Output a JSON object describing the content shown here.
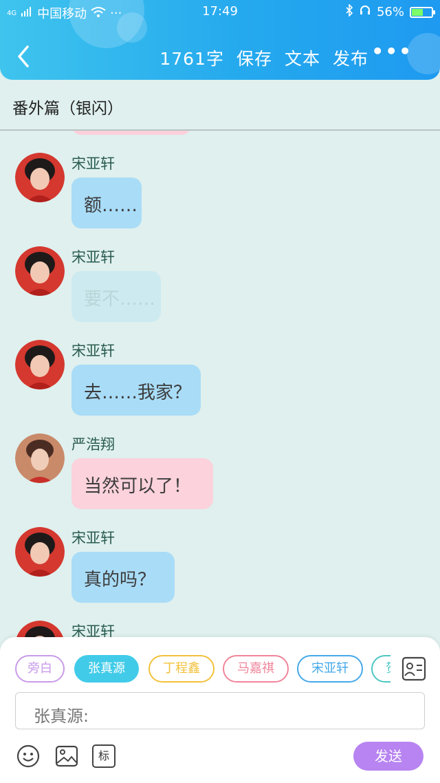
{
  "status": {
    "carrier": "中国移动",
    "network": "4G",
    "time": "17:49",
    "battery": "56%",
    "battery_level": 0.56
  },
  "nav": {
    "word_count": "1761字",
    "save": "保存",
    "text": "文本",
    "publish": "发布"
  },
  "title": "番外篇（银闪）",
  "messages": [
    {
      "speaker": "宋亚轩",
      "text": "额……"
    },
    {
      "speaker": "宋亚轩",
      "text": "要不……"
    },
    {
      "speaker": "宋亚轩",
      "text": "去……我家？"
    },
    {
      "speaker": "严浩翔",
      "text": "当然可以了！"
    },
    {
      "speaker": "宋亚轩",
      "text": "真的吗？"
    },
    {
      "speaker": "宋亚轩",
      "text": ""
    }
  ],
  "characters": [
    {
      "label": "旁白",
      "color": "#c99be8",
      "selected": false
    },
    {
      "label": "张真源",
      "color": "#41cbe9",
      "selected": true
    },
    {
      "label": "丁程鑫",
      "color": "#f2c13b",
      "selected": false
    },
    {
      "label": "马嘉祺",
      "color": "#f0859a",
      "selected": false
    },
    {
      "label": "宋亚轩",
      "color": "#45a9ea",
      "selected": false
    },
    {
      "label": "贺",
      "color": "#4cc7c2",
      "selected": false
    }
  ],
  "input": {
    "value": "张真源:"
  },
  "toolbar": {
    "tag_label": "标",
    "send_label": "发送"
  },
  "colors": {
    "header": "#25a9ee",
    "background": "#dff0ee",
    "send": "#b784f1"
  }
}
